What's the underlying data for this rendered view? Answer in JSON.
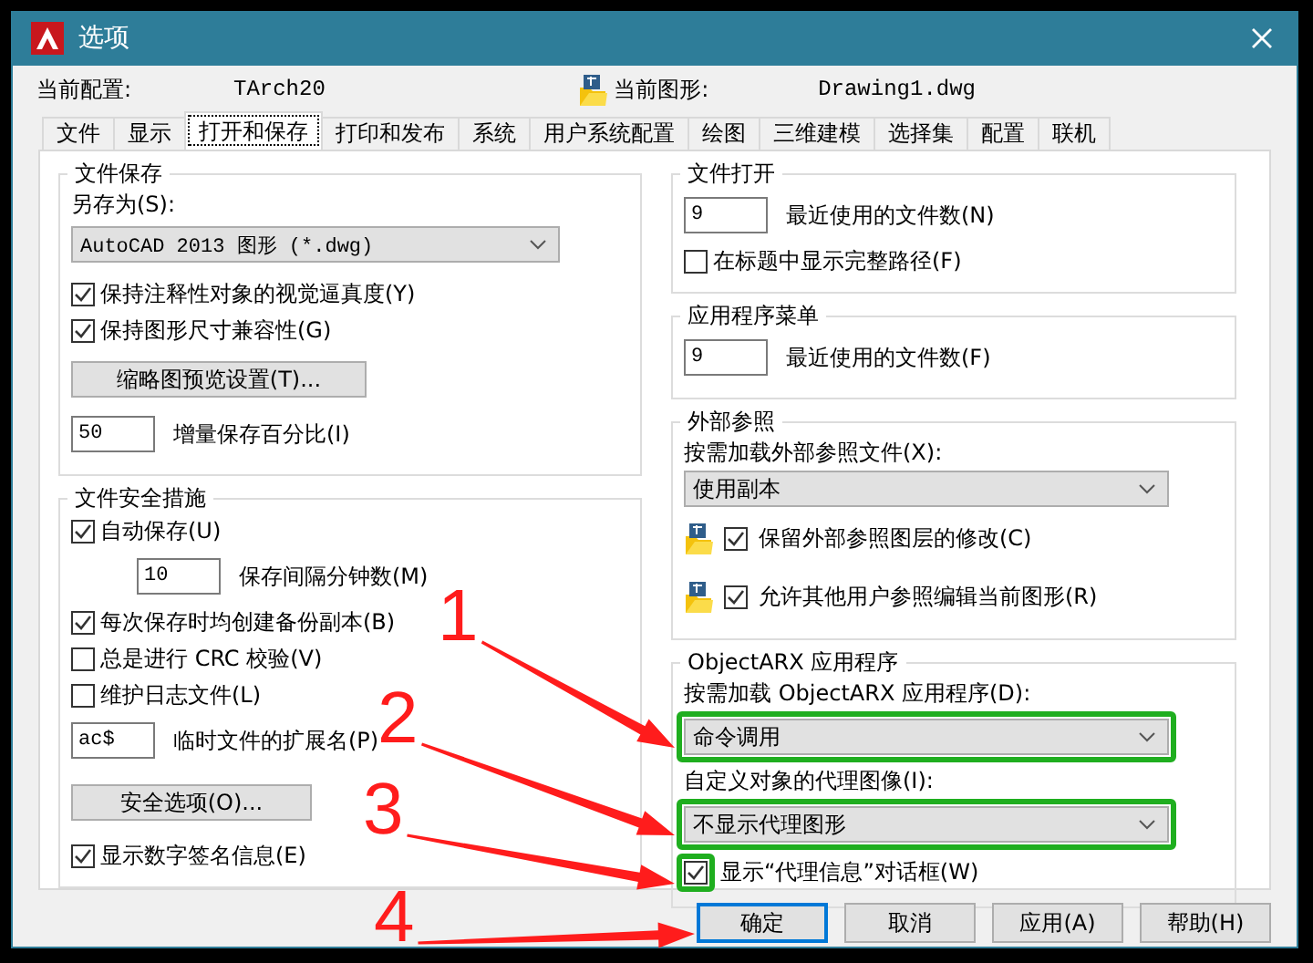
{
  "window": {
    "title": "选项"
  },
  "header": {
    "profile_label": "当前配置:",
    "profile": "TArch20",
    "drawing_label": "当前图形:",
    "drawing": "Drawing1.dwg"
  },
  "tabs": [
    {
      "label": "文件",
      "selected": false
    },
    {
      "label": "显示",
      "selected": false
    },
    {
      "label": "打开和保存",
      "selected": true
    },
    {
      "label": "打印和发布",
      "selected": false
    },
    {
      "label": "系统",
      "selected": false
    },
    {
      "label": "用户系统配置",
      "selected": false
    },
    {
      "label": "绘图",
      "selected": false
    },
    {
      "label": "三维建模",
      "selected": false
    },
    {
      "label": "选择集",
      "selected": false
    },
    {
      "label": "配置",
      "selected": false
    },
    {
      "label": "联机",
      "selected": false
    }
  ],
  "left_groups": [
    {
      "title": "文件保存",
      "items": [
        {
          "kind": "label",
          "text": "另存为(S):"
        },
        {
          "kind": "dropdown",
          "value": "AutoCAD 2013 图形 (*.dwg)",
          "mono": true
        },
        {
          "kind": "checkbox",
          "label": "保持注释性对象的视觉逼真度(Y)",
          "checked": true
        },
        {
          "kind": "checkbox",
          "label": "保持图形尺寸兼容性(G)",
          "checked": true
        },
        {
          "kind": "button",
          "label": "缩略图预览设置(T)..."
        },
        {
          "kind": "number",
          "value": "50",
          "text": "增量保存百分比(I)"
        }
      ]
    },
    {
      "title": "文件安全措施",
      "items": [
        {
          "kind": "checkbox",
          "label": "自动保存(U)",
          "checked": true
        },
        {
          "kind": "number",
          "value": "10",
          "text": "保存间隔分钟数(M)",
          "indent": true
        },
        {
          "kind": "checkbox",
          "label": "每次保存时均创建备份副本(B)",
          "checked": true
        },
        {
          "kind": "checkbox",
          "label": "总是进行 CRC 校验(V)",
          "checked": false
        },
        {
          "kind": "checkbox",
          "label": "维护日志文件(L)",
          "checked": false
        },
        {
          "kind": "number",
          "value": "ac$",
          "text": "临时文件的扩展名(P)"
        },
        {
          "kind": "button",
          "label": "安全选项(O)..."
        },
        {
          "kind": "checkbox",
          "label": "显示数字签名信息(E)",
          "checked": true
        }
      ]
    }
  ],
  "right_groups": [
    {
      "title": "文件打开",
      "items": [
        {
          "kind": "number",
          "value": "9",
          "text": "最近使用的文件数(N)"
        },
        {
          "kind": "checkbox",
          "label": "在标题中显示完整路径(F)",
          "checked": false
        }
      ]
    },
    {
      "title": "应用程序菜单",
      "items": [
        {
          "kind": "number",
          "value": "9",
          "text": "最近使用的文件数(F)"
        }
      ]
    },
    {
      "title": "外部参照",
      "items": [
        {
          "kind": "label",
          "text": "按需加载外部参照文件(X):"
        },
        {
          "kind": "dropdown",
          "value": "使用副本"
        },
        {
          "kind": "icon_checkbox",
          "label": "保留外部参照图层的修改(C)",
          "checked": true
        },
        {
          "kind": "icon_checkbox",
          "label": "允许其他用户参照编辑当前图形(R)",
          "checked": true
        }
      ]
    },
    {
      "title": "ObjectARX 应用程序",
      "items": [
        {
          "kind": "label",
          "text": "按需加载 ObjectARX 应用程序(D):"
        },
        {
          "kind": "dropdown",
          "value": "命令调用",
          "highlighted": true,
          "callout": "1"
        },
        {
          "kind": "label",
          "text": "自定义对象的代理图像(I):"
        },
        {
          "kind": "dropdown",
          "value": "不显示代理图形",
          "highlighted": true,
          "callout": "2"
        },
        {
          "kind": "checkbox",
          "label": "显示“代理信息”对话框(W)",
          "checked": true,
          "highlighted": true,
          "callout": "3"
        }
      ]
    }
  ],
  "buttons": [
    {
      "label": "确定",
      "default": true,
      "callout": "4"
    },
    {
      "label": "取消",
      "default": false
    },
    {
      "label": "应用(A)",
      "default": false
    },
    {
      "label": "帮助(H)",
      "default": false
    }
  ]
}
